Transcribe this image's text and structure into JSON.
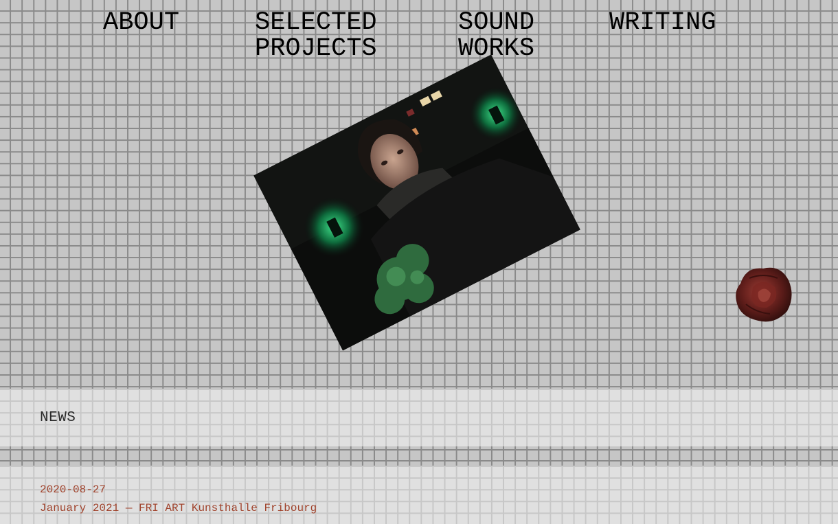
{
  "nav": {
    "items": [
      {
        "label": "ABOUT"
      },
      {
        "label": "SELECTED\nPROJECTS"
      },
      {
        "label": "SOUND\nWORKS"
      },
      {
        "label": "WRITING"
      }
    ]
  },
  "news": {
    "heading": "NEWS",
    "entries": [
      {
        "date": "2020-08-27",
        "text": "January 2021 — FRI ART Kunsthalle Fribourg"
      }
    ]
  },
  "colors": {
    "grid_bg": "#c6c6c6",
    "grid_line": "#8a8a8a",
    "band_bg": "#e0e0e0",
    "accent_text": "#a0432c"
  }
}
